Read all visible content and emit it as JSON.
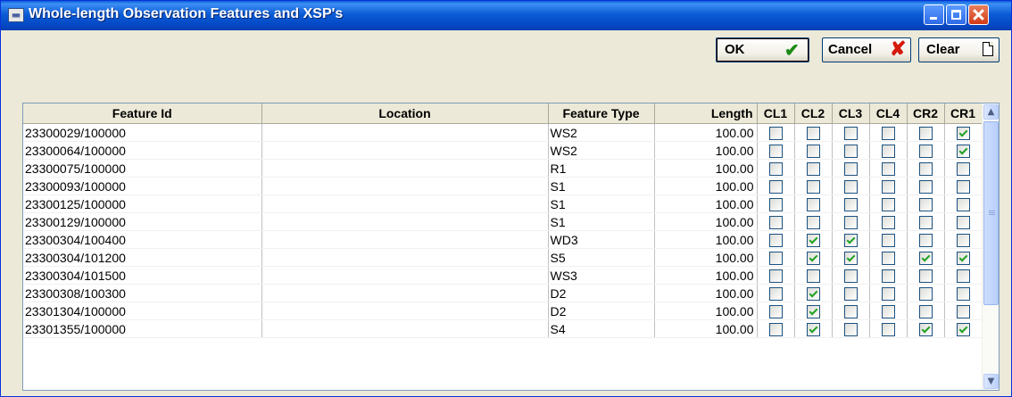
{
  "window": {
    "title": "Whole-length Observation Features and XSP's",
    "app_icon": "table-app-icon"
  },
  "toolbar": {
    "ok_label": "OK",
    "ok_icon": "green-checkmark-icon",
    "cancel_label": "Cancel",
    "cancel_icon": "red-cross-icon",
    "clear_label": "Clear",
    "clear_icon": "blank-document-icon"
  },
  "grid": {
    "columns": [
      "Feature Id",
      "Location",
      "Feature Type",
      "Length",
      "CL1",
      "CL2",
      "CL3",
      "CL4",
      "CR2",
      "CR1"
    ],
    "rows": [
      {
        "feature_id": "23300029/100000",
        "location": "",
        "type": "WS2",
        "length": "100.00",
        "cl1": false,
        "cl2": false,
        "cl3": false,
        "cl4": false,
        "cr2": false,
        "cr1": true
      },
      {
        "feature_id": "23300064/100000",
        "location": "",
        "type": "WS2",
        "length": "100.00",
        "cl1": false,
        "cl2": false,
        "cl3": false,
        "cl4": false,
        "cr2": false,
        "cr1": true
      },
      {
        "feature_id": "23300075/100000",
        "location": "",
        "type": "R1",
        "length": "100.00",
        "cl1": false,
        "cl2": false,
        "cl3": false,
        "cl4": false,
        "cr2": false,
        "cr1": false
      },
      {
        "feature_id": "23300093/100000",
        "location": "",
        "type": "S1",
        "length": "100.00",
        "cl1": false,
        "cl2": false,
        "cl3": false,
        "cl4": false,
        "cr2": false,
        "cr1": false
      },
      {
        "feature_id": "23300125/100000",
        "location": "",
        "type": "S1",
        "length": "100.00",
        "cl1": false,
        "cl2": false,
        "cl3": false,
        "cl4": false,
        "cr2": false,
        "cr1": false
      },
      {
        "feature_id": "23300129/100000",
        "location": "",
        "type": "S1",
        "length": "100.00",
        "cl1": false,
        "cl2": false,
        "cl3": false,
        "cl4": false,
        "cr2": false,
        "cr1": false
      },
      {
        "feature_id": "23300304/100400",
        "location": "",
        "type": "WD3",
        "length": "100.00",
        "cl1": false,
        "cl2": true,
        "cl3": true,
        "cl4": false,
        "cr2": false,
        "cr1": false
      },
      {
        "feature_id": "23300304/101200",
        "location": "",
        "type": "S5",
        "length": "100.00",
        "cl1": false,
        "cl2": true,
        "cl3": true,
        "cl4": false,
        "cr2": true,
        "cr1": true
      },
      {
        "feature_id": "23300304/101500",
        "location": "",
        "type": "WS3",
        "length": "100.00",
        "cl1": false,
        "cl2": false,
        "cl3": false,
        "cl4": false,
        "cr2": false,
        "cr1": false
      },
      {
        "feature_id": "23300308/100300",
        "location": "",
        "type": "D2",
        "length": "100.00",
        "cl1": false,
        "cl2": true,
        "cl3": false,
        "cl4": false,
        "cr2": false,
        "cr1": false
      },
      {
        "feature_id": "23301304/100000",
        "location": "",
        "type": "D2",
        "length": "100.00",
        "cl1": false,
        "cl2": true,
        "cl3": false,
        "cl4": false,
        "cr2": false,
        "cr1": false
      },
      {
        "feature_id": "23301355/100000",
        "location": "",
        "type": "S4",
        "length": "100.00",
        "cl1": false,
        "cl2": true,
        "cl3": false,
        "cl4": false,
        "cr2": true,
        "cr1": true
      }
    ]
  }
}
